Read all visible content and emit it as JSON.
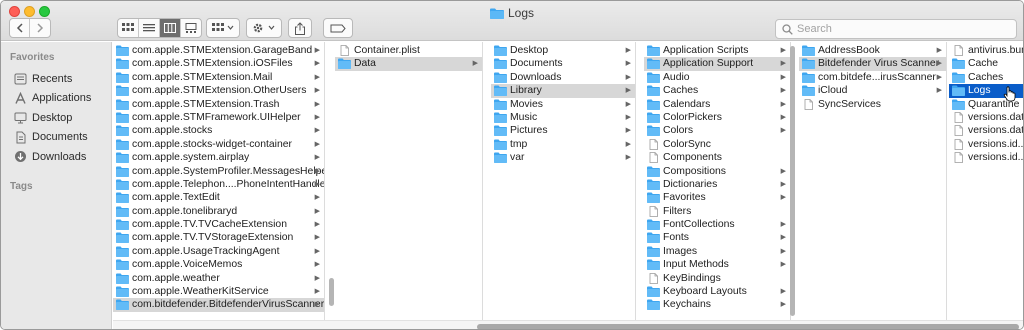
{
  "window": {
    "title": "Logs",
    "title_icon": "folder-icon"
  },
  "toolbar": {
    "back": "back-chevron-icon",
    "forward": "forward-chevron-icon",
    "view_icon": "icon-view-icon",
    "view_list": "list-view-icon",
    "view_column": "column-view-icon",
    "view_gallery": "gallery-view-icon",
    "group_menu": "group-by-icon",
    "action_menu": "gear-icon",
    "share": "share-icon",
    "tags": "tag-icon"
  },
  "search": {
    "placeholder": "Search"
  },
  "sidebar": {
    "favorites_label": "Favorites",
    "items": [
      {
        "label": "Recents",
        "icon": "clock-icon"
      },
      {
        "label": "Applications",
        "icon": "applications-icon"
      },
      {
        "label": "Desktop",
        "icon": "desktop-icon"
      },
      {
        "label": "Documents",
        "icon": "document-icon"
      },
      {
        "label": "Downloads",
        "icon": "download-icon"
      }
    ],
    "tags_label": "Tags"
  },
  "columns": [
    {
      "name": "containers",
      "rows": [
        {
          "label": "com.apple.STMExtension.GarageBand",
          "icon": "folder",
          "arrow": true
        },
        {
          "label": "com.apple.STMExtension.iOSFiles",
          "icon": "folder",
          "arrow": true
        },
        {
          "label": "com.apple.STMExtension.Mail",
          "icon": "folder",
          "arrow": true
        },
        {
          "label": "com.apple.STMExtension.OtherUsers",
          "icon": "folder",
          "arrow": true
        },
        {
          "label": "com.apple.STMExtension.Trash",
          "icon": "folder",
          "arrow": true
        },
        {
          "label": "com.apple.STMFramework.UIHelper",
          "icon": "folder",
          "arrow": true
        },
        {
          "label": "com.apple.stocks",
          "icon": "folder",
          "arrow": true
        },
        {
          "label": "com.apple.stocks-widget-container",
          "icon": "folder",
          "arrow": true
        },
        {
          "label": "com.apple.system.airplay",
          "icon": "folder",
          "arrow": true
        },
        {
          "label": "com.apple.SystemProfiler.MessagesHelper",
          "icon": "folder",
          "arrow": true
        },
        {
          "label": "com.apple.Telephon....PhoneIntentHandler",
          "icon": "folder",
          "arrow": true
        },
        {
          "label": "com.apple.TextEdit",
          "icon": "folder",
          "arrow": true
        },
        {
          "label": "com.apple.tonelibraryd",
          "icon": "folder",
          "arrow": true
        },
        {
          "label": "com.apple.TV.TVCacheExtension",
          "icon": "folder",
          "arrow": true
        },
        {
          "label": "com.apple.TV.TVStorageExtension",
          "icon": "folder",
          "arrow": true
        },
        {
          "label": "com.apple.UsageTrackingAgent",
          "icon": "folder",
          "arrow": true
        },
        {
          "label": "com.apple.VoiceMemos",
          "icon": "folder",
          "arrow": true
        },
        {
          "label": "com.apple.weather",
          "icon": "folder",
          "arrow": true
        },
        {
          "label": "com.apple.WeatherKitService",
          "icon": "folder",
          "arrow": true
        },
        {
          "label": "com.bitdefender.BitdefenderVirusScanner",
          "icon": "folder",
          "arrow": true,
          "selected": "gray"
        }
      ]
    },
    {
      "name": "bitdefender-container",
      "rows": [
        {
          "label": "Container.plist",
          "icon": "file",
          "arrow": false
        },
        {
          "label": "Data",
          "icon": "folder",
          "arrow": true,
          "selected": "gray"
        }
      ]
    },
    {
      "name": "data",
      "rows": [
        {
          "label": "Desktop",
          "icon": "folder",
          "arrow": true
        },
        {
          "label": "Documents",
          "icon": "folder",
          "arrow": true
        },
        {
          "label": "Downloads",
          "icon": "folder",
          "arrow": true
        },
        {
          "label": "Library",
          "icon": "folder",
          "arrow": true,
          "selected": "gray"
        },
        {
          "label": "Movies",
          "icon": "folder",
          "arrow": true
        },
        {
          "label": "Music",
          "icon": "folder",
          "arrow": true
        },
        {
          "label": "Pictures",
          "icon": "folder",
          "arrow": true
        },
        {
          "label": "tmp",
          "icon": "folder",
          "arrow": true
        },
        {
          "label": "var",
          "icon": "folder",
          "arrow": true
        }
      ]
    },
    {
      "name": "library",
      "rows": [
        {
          "label": "Application Scripts",
          "icon": "folder",
          "arrow": true
        },
        {
          "label": "Application Support",
          "icon": "folder",
          "arrow": true,
          "selected": "gray"
        },
        {
          "label": "Audio",
          "icon": "folder",
          "arrow": true
        },
        {
          "label": "Caches",
          "icon": "folder",
          "arrow": true
        },
        {
          "label": "Calendars",
          "icon": "folder",
          "arrow": true
        },
        {
          "label": "ColorPickers",
          "icon": "folder",
          "arrow": true
        },
        {
          "label": "Colors",
          "icon": "folder",
          "arrow": true
        },
        {
          "label": "ColorSync",
          "icon": "file",
          "arrow": false
        },
        {
          "label": "Components",
          "icon": "file",
          "arrow": false
        },
        {
          "label": "Compositions",
          "icon": "folder",
          "arrow": true
        },
        {
          "label": "Dictionaries",
          "icon": "folder",
          "arrow": true
        },
        {
          "label": "Favorites",
          "icon": "folder",
          "arrow": true
        },
        {
          "label": "Filters",
          "icon": "file",
          "arrow": false
        },
        {
          "label": "FontCollections",
          "icon": "folder",
          "arrow": true
        },
        {
          "label": "Fonts",
          "icon": "folder",
          "arrow": true
        },
        {
          "label": "Images",
          "icon": "folder",
          "arrow": true
        },
        {
          "label": "Input Methods",
          "icon": "folder",
          "arrow": true
        },
        {
          "label": "KeyBindings",
          "icon": "file",
          "arrow": false
        },
        {
          "label": "Keyboard Layouts",
          "icon": "folder",
          "arrow": true
        },
        {
          "label": "Keychains",
          "icon": "folder",
          "arrow": true
        }
      ]
    },
    {
      "name": "application-support",
      "rows": [
        {
          "label": "AddressBook",
          "icon": "folder",
          "arrow": true
        },
        {
          "label": "Bitdefender Virus Scanner",
          "icon": "folder",
          "arrow": true,
          "selected": "gray"
        },
        {
          "label": "com.bitdefe...irusScanner",
          "icon": "folder",
          "arrow": true
        },
        {
          "label": "iCloud",
          "icon": "folder",
          "arrow": true
        },
        {
          "label": "SyncServices",
          "icon": "file",
          "arrow": false
        }
      ]
    },
    {
      "name": "bitdefender-virus-scanner",
      "rows": [
        {
          "label": "antivirus.bun",
          "icon": "file",
          "arrow": false
        },
        {
          "label": "Cache",
          "icon": "folder",
          "arrow": false
        },
        {
          "label": "Caches",
          "icon": "folder",
          "arrow": false
        },
        {
          "label": "Logs",
          "icon": "folder",
          "arrow": false,
          "selected": "blue"
        },
        {
          "label": "Quarantine",
          "icon": "folder",
          "arrow": false
        },
        {
          "label": "versions.dat.",
          "icon": "file",
          "arrow": false
        },
        {
          "label": "versions.dat.",
          "icon": "file",
          "arrow": false
        },
        {
          "label": "versions.id...",
          "icon": "file",
          "arrow": false
        },
        {
          "label": "versions.id...",
          "icon": "file",
          "arrow": false
        }
      ]
    }
  ],
  "colors": {
    "selection_blue": "#0a5dc9",
    "selection_gray": "#d7d7d7",
    "folder_blue": "#3ea6f0"
  }
}
